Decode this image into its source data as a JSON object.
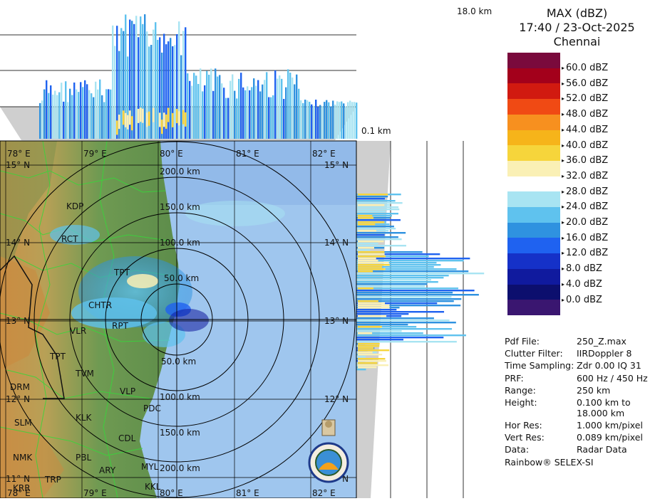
{
  "product": "MAX (dBZ)",
  "time": "17:40 / 23-Oct-2025",
  "station": "Chennai",
  "height_top_label": "18.0 km",
  "height_bottom_label": "0.1 km",
  "lon_labels": [
    "78° E",
    "79° E",
    "80° E",
    "81° E",
    "82° E"
  ],
  "lat_labels": [
    "15° N",
    "14° N",
    "13° N",
    "12° N",
    "11° N"
  ],
  "range_labels": [
    "200.0 km",
    "150.0 km",
    "100.0 km",
    "50.0 km",
    "50.0 km",
    "100.0 km",
    "150.0 km",
    "200.0 km"
  ],
  "places": [
    "KDP",
    "RCT",
    "TPT",
    "CHTR",
    "RPT",
    "VLR",
    "TPT",
    "TVM",
    "DRM",
    "VLP",
    "PDC",
    "SLM",
    "KLK",
    "CDL",
    "NMK",
    "PBL",
    "ARY",
    "MYL",
    "TRP",
    "KRR",
    "KKL"
  ],
  "scale": [
    {
      "label": "60.0 dBZ",
      "color": "#7a0a3c"
    },
    {
      "label": "56.0 dBZ",
      "color": "#a3001b"
    },
    {
      "label": "52.0 dBZ",
      "color": "#d11a10"
    },
    {
      "label": "48.0 dBZ",
      "color": "#f04a14"
    },
    {
      "label": "44.0 dBZ",
      "color": "#f7901f"
    },
    {
      "label": "40.0 dBZ",
      "color": "#f6b41a"
    },
    {
      "label": "36.0 dBZ",
      "color": "#f6d53b"
    },
    {
      "label": "32.0 dBZ",
      "color": "#faf0b5"
    },
    {
      "label": "28.0 dBZ",
      "color": "#ffffff"
    },
    {
      "label": "24.0 dBZ",
      "color": "#a8e4f2"
    },
    {
      "label": "20.0 dBZ",
      "color": "#5fc2ee"
    },
    {
      "label": "16.0 dBZ",
      "color": "#2f92e0"
    },
    {
      "label": "12.0 dBZ",
      "color": "#1f62f0"
    },
    {
      "label": "8.0 dBZ",
      "color": "#1531c8"
    },
    {
      "label": "4.0 dBZ",
      "color": "#101a9e"
    },
    {
      "label": "0.0 dBZ",
      "color": "#0c0f6e"
    },
    {
      "label": "",
      "color": "#3a1670"
    }
  ],
  "info": [
    {
      "key": "Pdf File:",
      "value": "250_Z.max"
    },
    {
      "key": "Clutter Filter:",
      "value": "IIRDoppler 8"
    },
    {
      "key": "Time Sampling:",
      "value": "Zdr 0.00 IQ 31"
    },
    {
      "key": "PRF:",
      "value": "600 Hz / 450 Hz"
    },
    {
      "key": "Range:",
      "value": "250 km"
    },
    {
      "key": "Height:",
      "value": "0.100 km to\n18.000 km"
    },
    {
      "key": "Hor Res:",
      "value": "1.000 km/pixel"
    },
    {
      "key": "Vert Res:",
      "value": "0.089 km/pixel"
    },
    {
      "key": "Data:",
      "value": "Radar Data"
    }
  ],
  "software": "Rainbow® SELEX-SI"
}
